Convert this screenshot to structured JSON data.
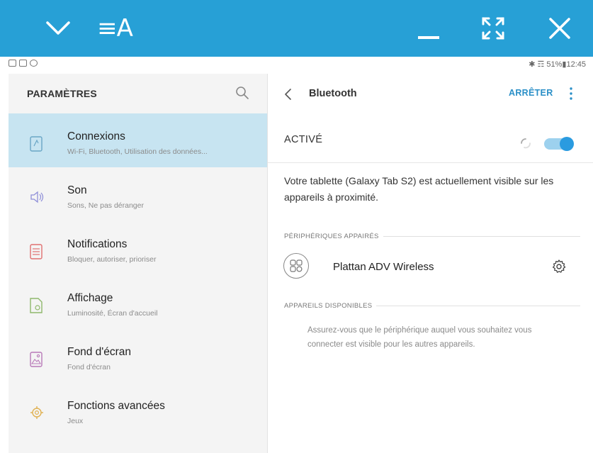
{
  "toolbar": {
    "ea_label": "≡A",
    "icons": [
      "chevron-down-icon",
      "minimize-icon",
      "maximize-icon",
      "close-icon"
    ],
    "accent": "#27a0d6"
  },
  "statusbar": {
    "right_text": "✱ ☶ 51%▮12:45"
  },
  "settings": {
    "title": "PARAMÈTRES",
    "items": [
      {
        "label": "Connexions",
        "sub": "Wi-Fi, Bluetooth, Utilisation des données...",
        "icon": "connections-icon"
      },
      {
        "label": "Son",
        "sub": "Sons, Ne pas déranger",
        "icon": "volume-icon"
      },
      {
        "label": "Notifications",
        "sub": "Bloquer, autoriser, prioriser",
        "icon": "notifications-icon"
      },
      {
        "label": "Affichage",
        "sub": "Luminosité, Écran d'accueil",
        "icon": "display-icon"
      },
      {
        "label": "Fond d'écran",
        "sub": "Fond d'écran",
        "icon": "wallpaper-icon"
      },
      {
        "label": "Fonctions avancées",
        "sub": "Jeux",
        "icon": "advanced-features-icon"
      }
    ],
    "selected_color": "#c7e4f1"
  },
  "bluetooth": {
    "title": "Bluetooth",
    "stop_label": "ARRÊTER",
    "active_label": "ACTIVÉ",
    "toggle_on": true,
    "visible_text": "Votre tablette (Galaxy Tab S2) est actuellement visible sur les appareils à proximité.",
    "paired_header": "PÉRIPHÉRIQUES APPAIRÉS",
    "paired_devices": [
      {
        "name": "Plattan ADV Wireless"
      }
    ],
    "available_header": "APPAREILS DISPONIBLES",
    "available_text": "Assurez-vous que le périphérique auquel vous souhaitez vous connecter est visible pour les autres appareils.",
    "accent": "#2a8fc7"
  }
}
